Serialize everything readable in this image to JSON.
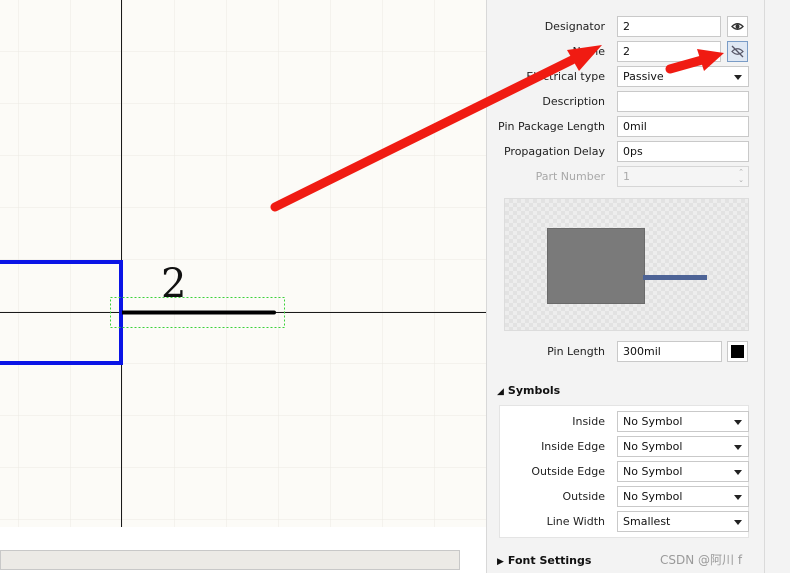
{
  "canvas": {
    "pin_designator_text": "2"
  },
  "panel": {
    "designator": {
      "label": "Designator",
      "value": "2"
    },
    "name": {
      "label": "Name",
      "value": "2"
    },
    "electrical_type": {
      "label": "Electrical type",
      "value": "Passive"
    },
    "description": {
      "label": "Description",
      "value": ""
    },
    "pin_package_length": {
      "label": "Pin Package Length",
      "value": "0mil"
    },
    "propagation_delay": {
      "label": "Propagation Delay",
      "value": "0ps"
    },
    "part_number": {
      "label": "Part Number",
      "value": "1"
    },
    "pin_length": {
      "label": "Pin Length",
      "value": "300mil",
      "color": "#000000"
    },
    "symbols_header": "Symbols",
    "symbols": {
      "inside": {
        "label": "Inside",
        "value": "No Symbol"
      },
      "inside_edge": {
        "label": "Inside Edge",
        "value": "No Symbol"
      },
      "outside_edge": {
        "label": "Outside Edge",
        "value": "No Symbol"
      },
      "outside": {
        "label": "Outside",
        "value": "No Symbol"
      },
      "line_width": {
        "label": "Line Width",
        "value": "Smallest"
      }
    },
    "font_settings_header": "Font Settings"
  },
  "watermark": "CSDN @阿川 f",
  "colors": {
    "component_border": "#0a14e6",
    "pin": "#000000",
    "selection": "#3bd13b",
    "annotation_arrow": "#f01b12",
    "active_button": "#dfe8f4"
  },
  "icons": [
    "eye-icon",
    "eye-off-icon",
    "chevron-down-icon",
    "collapse-triangle-icon",
    "expand-triangle-icon"
  ]
}
